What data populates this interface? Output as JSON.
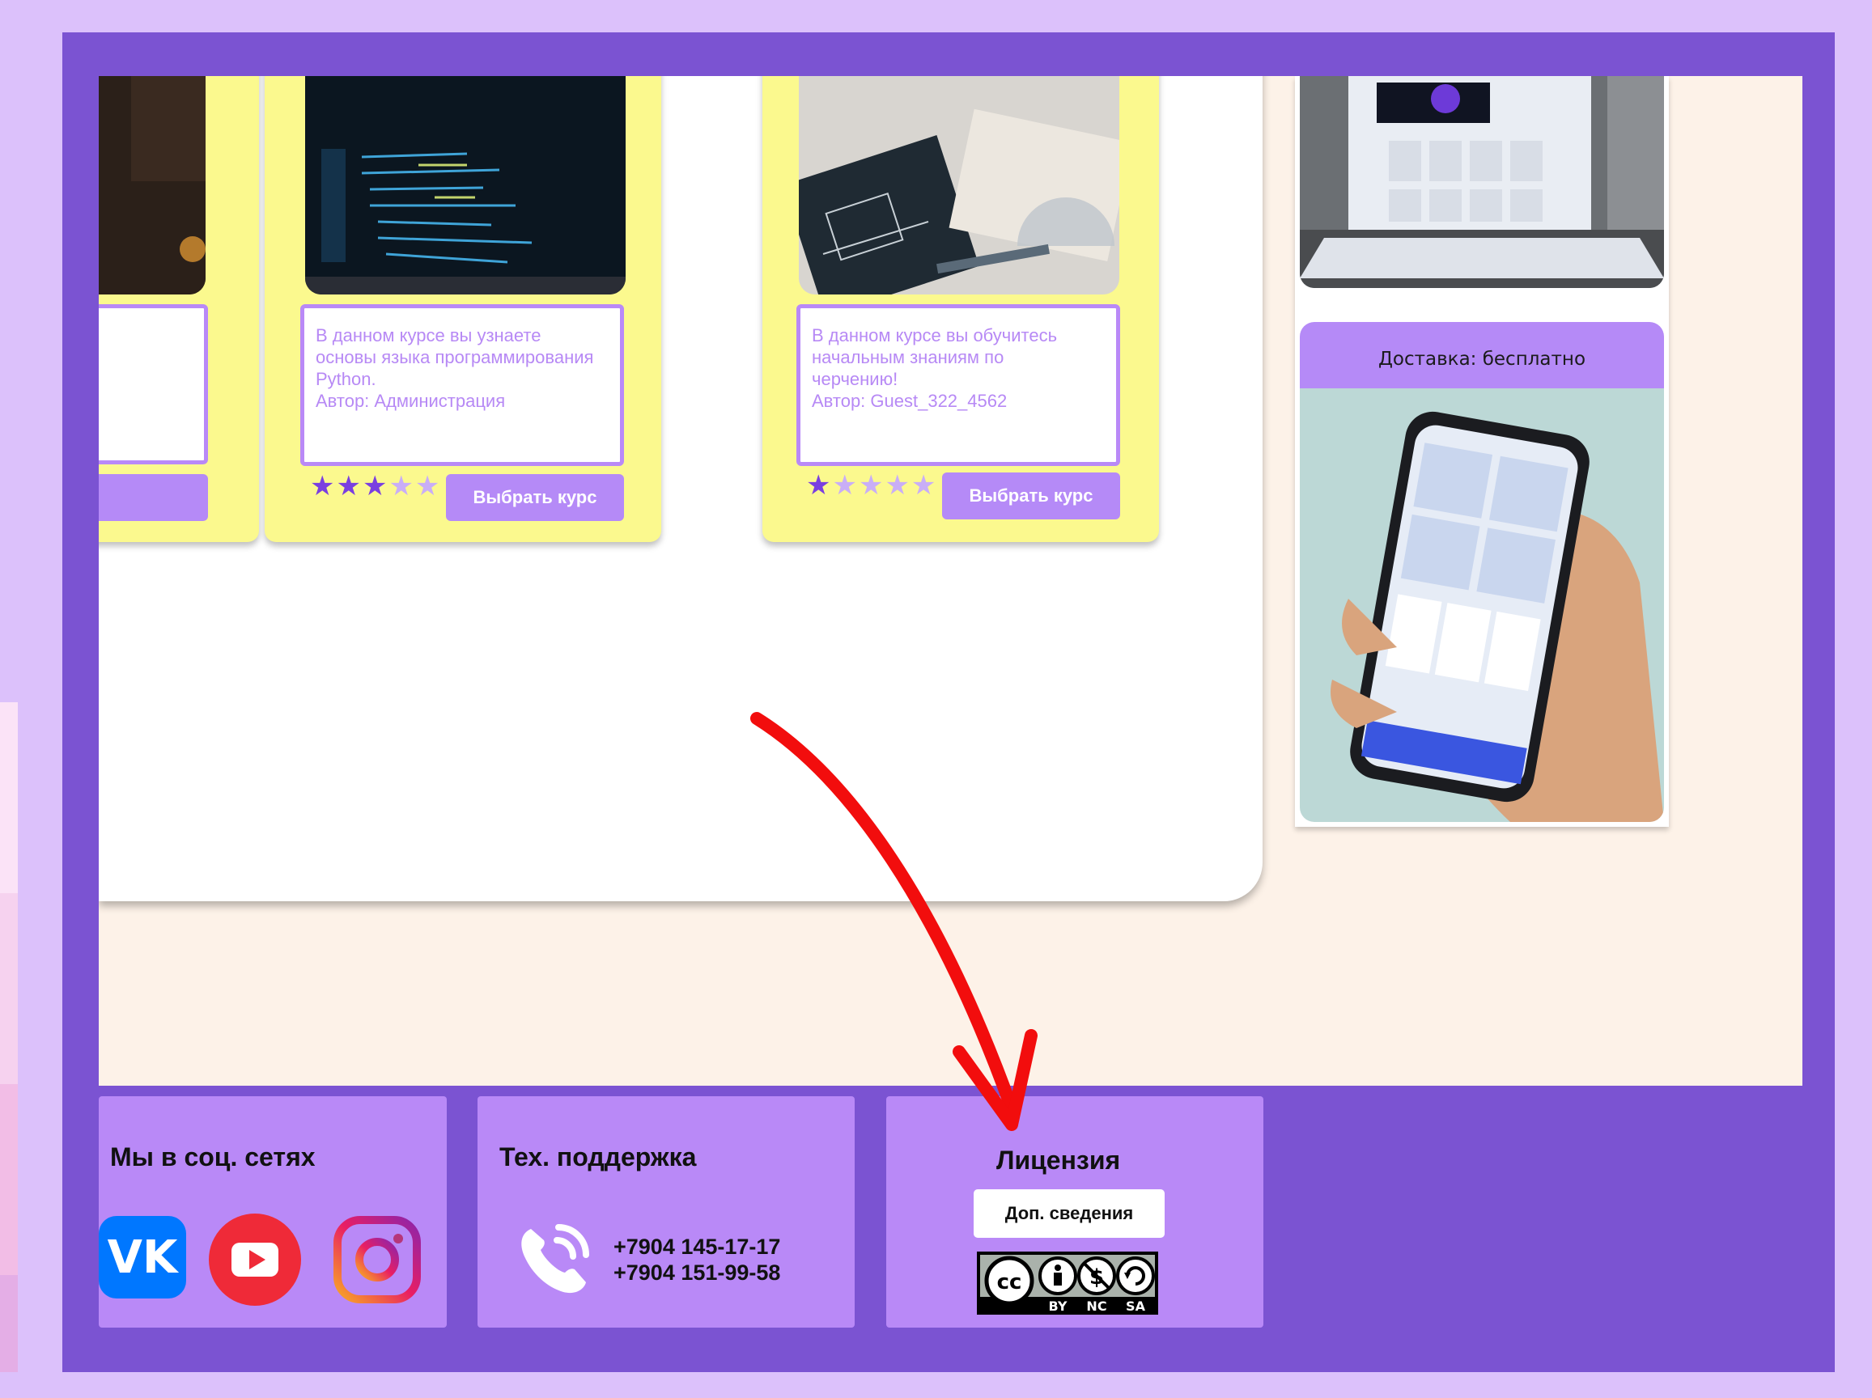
{
  "colors": {
    "outer_bg": "#dcc1fb",
    "frame": "#7b53d2",
    "content_bg": "#fdf2e8",
    "card_bg": "#fbf98e",
    "accent": "#b58af7",
    "annotation_arrow": "#f20d0d"
  },
  "courses": [
    {
      "description": "",
      "button": "",
      "rating": 0
    },
    {
      "description": "В данном курсе вы узнаете\nосновы языка программирования\nPython.\nАвтор: Администрация",
      "button": "Выбрать курс",
      "rating": 3,
      "rating_max": 5
    },
    {
      "description": "В данном курсе вы обучитесь\nначальным знаниям по\nчерчению!\nАвтор: Guest_322_4562",
      "button": "Выбрать курс",
      "rating": 1,
      "rating_max": 5
    }
  ],
  "sidebar": {
    "delivery_label": "Доставка: бесплатно"
  },
  "footer": {
    "social": {
      "title": "Мы в соц. сетях",
      "icons": [
        "vk-icon",
        "youtube-icon",
        "instagram-icon"
      ]
    },
    "support": {
      "title": "Тех. поддержка",
      "phones": [
        "+7904 145-17-17",
        "+7904 151-99-58"
      ]
    },
    "license": {
      "title": "Лицензия",
      "button": "Доп. сведения",
      "badge": "cc",
      "badge_labels": [
        "BY",
        "NC",
        "SA"
      ]
    }
  }
}
